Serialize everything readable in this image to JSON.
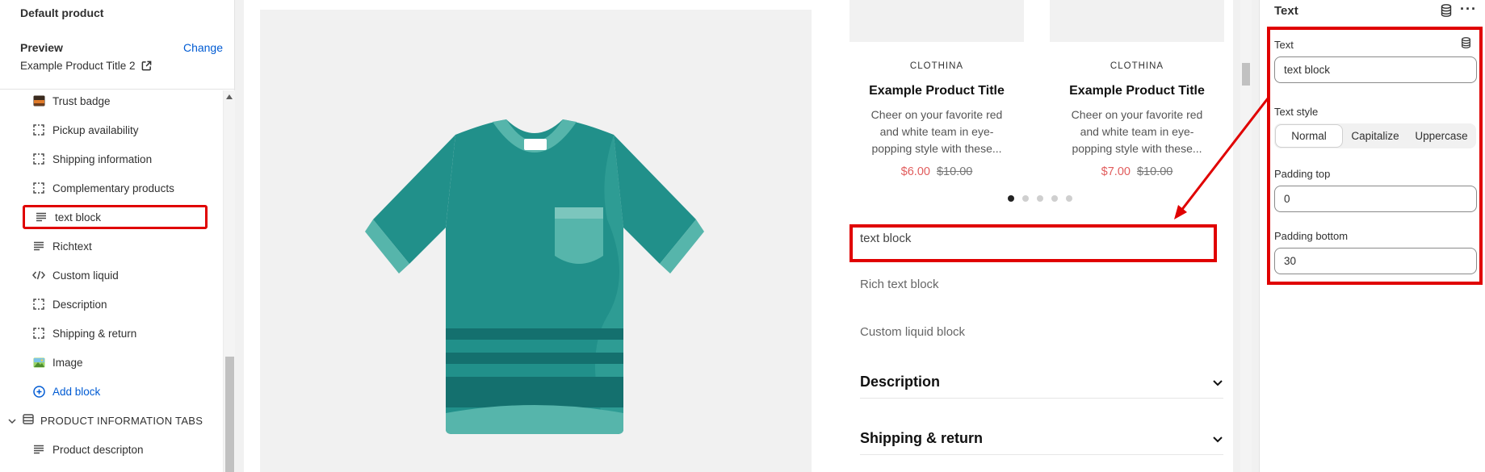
{
  "sidebar": {
    "title": "Default product",
    "preview_label": "Preview",
    "change_link": "Change",
    "preview_product": "Example Product Title 2",
    "items": [
      {
        "label": "Trust badge",
        "icon": "image-colored-icon"
      },
      {
        "label": "Pickup availability",
        "icon": "dashed-square-icon"
      },
      {
        "label": "Shipping information",
        "icon": "dashed-square-icon"
      },
      {
        "label": "Complementary products",
        "icon": "dashed-square-icon"
      },
      {
        "label": "text block",
        "icon": "text-lines-icon",
        "selected": true
      },
      {
        "label": "Richtext",
        "icon": "text-lines-icon"
      },
      {
        "label": "Custom liquid",
        "icon": "code-icon"
      },
      {
        "label": "Description",
        "icon": "dashed-square-icon"
      },
      {
        "label": "Shipping & return",
        "icon": "dashed-square-icon"
      },
      {
        "label": "Image",
        "icon": "image-colored-icon"
      }
    ],
    "add_block": "Add block",
    "section_label": "PRODUCT INFORMATION TABS",
    "section_child": "Product descripton"
  },
  "preview": {
    "cards": [
      {
        "brand": "CLOTHINA",
        "title": "Example Product Title",
        "desc": "Cheer on your favorite red and white team in eye-popping style with these...",
        "price": "$6.00",
        "old_price": "$10.00"
      },
      {
        "brand": "CLOTHINA",
        "title": "Example Product Title",
        "desc": "Cheer on your favorite red and white team in eye-popping style with these...",
        "price": "$7.00",
        "old_price": "$10.00"
      }
    ],
    "text_block": "text block",
    "rich_text": "Rich text block",
    "custom_liquid": "Custom liquid block",
    "accordion": [
      "Description",
      "Shipping & return"
    ]
  },
  "settings": {
    "title": "Text",
    "text_label": "Text",
    "text_value": "text block",
    "text_style_label": "Text style",
    "text_style_options": [
      "Normal",
      "Capitalize",
      "Uppercase"
    ],
    "text_style_selected": "Normal",
    "padding_top_label": "Padding top",
    "padding_top_value": "0",
    "padding_bottom_label": "Padding bottom",
    "padding_bottom_value": "30"
  },
  "colors": {
    "accent_blue": "#005bd3",
    "highlight_red": "#e00000",
    "shirt_teal": "#21908a",
    "sale_price": "#e15c5c"
  }
}
